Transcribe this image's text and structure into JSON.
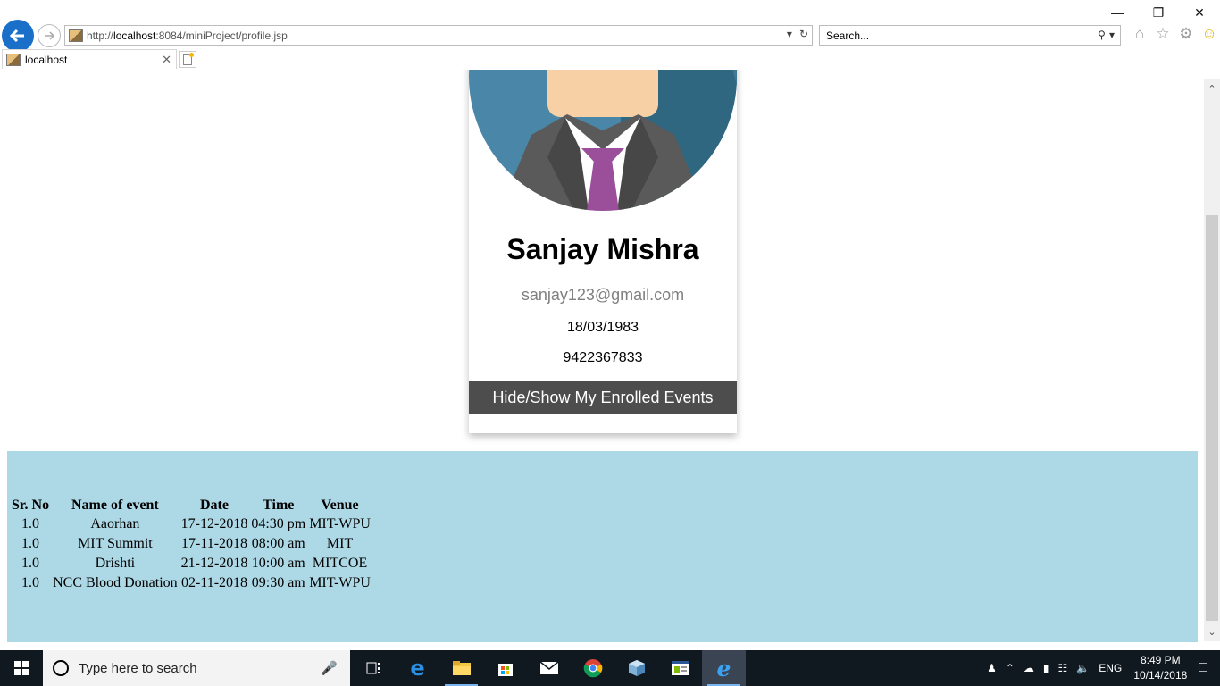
{
  "browser": {
    "url_prefix": "http://",
    "url_host": "localhost",
    "url_rest": ":8084/miniProject/profile.jsp",
    "search_placeholder": "Search...",
    "tab_title": "localhost"
  },
  "profile": {
    "name": "Sanjay Mishra",
    "email": "sanjay123@gmail.com",
    "dob": "18/03/1983",
    "phone": "9422367833",
    "toggle_label": "Hide/Show My Enrolled Events"
  },
  "events": {
    "headers": [
      "Sr. No",
      "Name of event",
      "Date",
      "Time",
      "Venue"
    ],
    "rows": [
      [
        "1.0",
        "Aaorhan",
        "17-12-2018",
        "04:30 pm",
        "MIT-WPU"
      ],
      [
        "1.0",
        "MIT Summit",
        "17-11-2018",
        "08:00 am",
        "MIT"
      ],
      [
        "1.0",
        "Drishti",
        "21-12-2018",
        "10:00 am",
        "MITCOE"
      ],
      [
        "1.0",
        "NCC Blood Donation",
        "02-11-2018",
        "09:30 am",
        "MIT-WPU"
      ]
    ]
  },
  "taskbar": {
    "search_placeholder": "Type here to search",
    "lang": "ENG",
    "time": "8:49 PM",
    "date": "10/14/2018"
  },
  "colors": {
    "accent_blue": "#1a6fc9",
    "panel_bg": "#add8e6",
    "button_bg": "#4d4d4d",
    "tie": "#9b4f9a",
    "taskbar": "#101820"
  }
}
